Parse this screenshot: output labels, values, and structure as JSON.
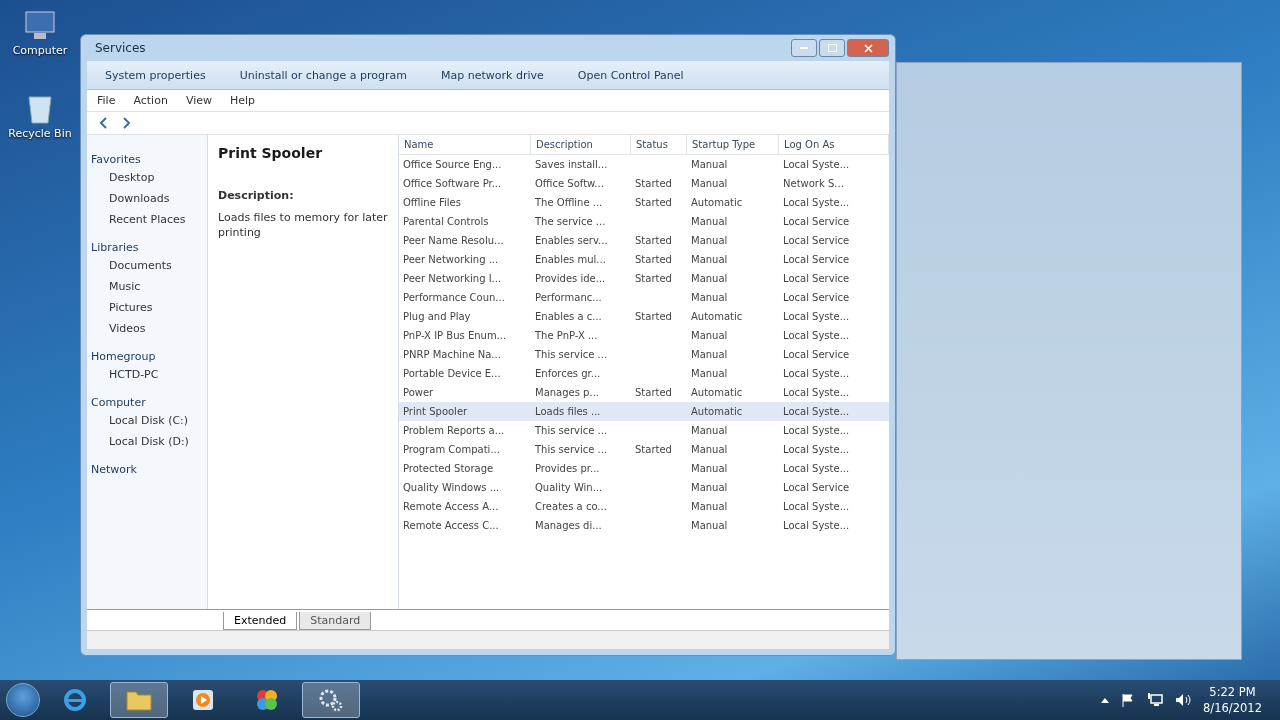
{
  "desktop_icons": [
    {
      "kind": "computer",
      "label": "Computer"
    },
    {
      "kind": "recycle",
      "label": "Recycle Bin"
    }
  ],
  "window": {
    "title": "Services"
  },
  "command_bar": [
    "System properties",
    "Uninstall or change a program",
    "Map network drive",
    "Open Control Panel"
  ],
  "menu": [
    "File",
    "Action",
    "View",
    "Help"
  ],
  "nav_pane": [
    {
      "label": "Favorites",
      "children": [
        {
          "label": "Desktop"
        },
        {
          "label": "Downloads"
        },
        {
          "label": "Recent Places"
        }
      ]
    },
    {
      "label": "Libraries",
      "children": [
        {
          "label": "Documents"
        },
        {
          "label": "Music"
        },
        {
          "label": "Pictures"
        },
        {
          "label": "Videos"
        }
      ]
    },
    {
      "label": "Homegroup",
      "children": [
        {
          "label": "HCTD-PC"
        }
      ]
    },
    {
      "label": "Computer",
      "children": [
        {
          "label": "Local Disk (C:)"
        },
        {
          "label": "Local Disk (D:)"
        }
      ]
    },
    {
      "label": "Network"
    }
  ],
  "detail": {
    "title": "Print Spooler",
    "description_label": "Description:",
    "description": "Loads files to memory for later printing"
  },
  "table": {
    "columns": [
      "Name",
      "Description",
      "Status",
      "Startup Type",
      "Log On As"
    ],
    "rows": [
      {
        "cells": [
          "Office Source Eng...",
          "Saves install...",
          "",
          "Manual",
          "Local Syste..."
        ],
        "selected": false
      },
      {
        "cells": [
          "Office Software Pr...",
          "Office Softw...",
          "Started",
          "Manual",
          "Network S..."
        ],
        "selected": false
      },
      {
        "cells": [
          "Offline Files",
          "The Offline ...",
          "Started",
          "Automatic",
          "Local Syste..."
        ],
        "selected": false
      },
      {
        "cells": [
          "Parental Controls",
          "The service ...",
          "",
          "Manual",
          "Local Service"
        ],
        "selected": false
      },
      {
        "cells": [
          "Peer Name Resolu...",
          "Enables serv...",
          "Started",
          "Manual",
          "Local Service"
        ],
        "selected": false
      },
      {
        "cells": [
          "Peer Networking ...",
          "Enables mul...",
          "Started",
          "Manual",
          "Local Service"
        ],
        "selected": false
      },
      {
        "cells": [
          "Peer Networking I...",
          "Provides ide...",
          "Started",
          "Manual",
          "Local Service"
        ],
        "selected": false
      },
      {
        "cells": [
          "Performance Coun...",
          "Performanc...",
          "",
          "Manual",
          "Local Service"
        ],
        "selected": false
      },
      {
        "cells": [
          "Plug and Play",
          "Enables a c...",
          "Started",
          "Automatic",
          "Local Syste..."
        ],
        "selected": false
      },
      {
        "cells": [
          "PnP-X IP Bus Enum...",
          "The PnP-X ...",
          "",
          "Manual",
          "Local Syste..."
        ],
        "selected": false
      },
      {
        "cells": [
          "PNRP Machine Na...",
          "This service ...",
          "",
          "Manual",
          "Local Service"
        ],
        "selected": false
      },
      {
        "cells": [
          "Portable Device E...",
          "Enforces gr...",
          "",
          "Manual",
          "Local Syste..."
        ],
        "selected": false
      },
      {
        "cells": [
          "Power",
          "Manages p...",
          "Started",
          "Automatic",
          "Local Syste..."
        ],
        "selected": false
      },
      {
        "cells": [
          "Print Spooler",
          "Loads files ...",
          "",
          "Automatic",
          "Local Syste..."
        ],
        "selected": true
      },
      {
        "cells": [
          "Problem Reports a...",
          "This service ...",
          "",
          "Manual",
          "Local Syste..."
        ],
        "selected": false
      },
      {
        "cells": [
          "Program Compati...",
          "This service ...",
          "Started",
          "Manual",
          "Local Syste..."
        ],
        "selected": false
      },
      {
        "cells": [
          "Protected Storage",
          "Provides pr...",
          "",
          "Manual",
          "Local Syste..."
        ],
        "selected": false
      },
      {
        "cells": [
          "Quality Windows ...",
          "Quality Win...",
          "",
          "Manual",
          "Local Service"
        ],
        "selected": false
      },
      {
        "cells": [
          "Remote Access A...",
          "Creates a co...",
          "",
          "Manual",
          "Local Syste..."
        ],
        "selected": false
      },
      {
        "cells": [
          "Remote Access C...",
          "Manages di...",
          "",
          "Manual",
          "Local Syste..."
        ],
        "selected": false
      }
    ]
  },
  "tabs": [
    {
      "label": "Extended",
      "selected": true
    },
    {
      "label": "Standard",
      "selected": false
    }
  ],
  "taskbar": {
    "buttons": [
      {
        "kind": "browser",
        "active": false
      },
      {
        "kind": "folder",
        "active": true
      },
      {
        "kind": "media",
        "active": false
      },
      {
        "kind": "palette",
        "active": false
      },
      {
        "kind": "gears",
        "active": true
      }
    ],
    "clock": {
      "time": "5:22 PM",
      "date": "8/16/2012"
    }
  }
}
